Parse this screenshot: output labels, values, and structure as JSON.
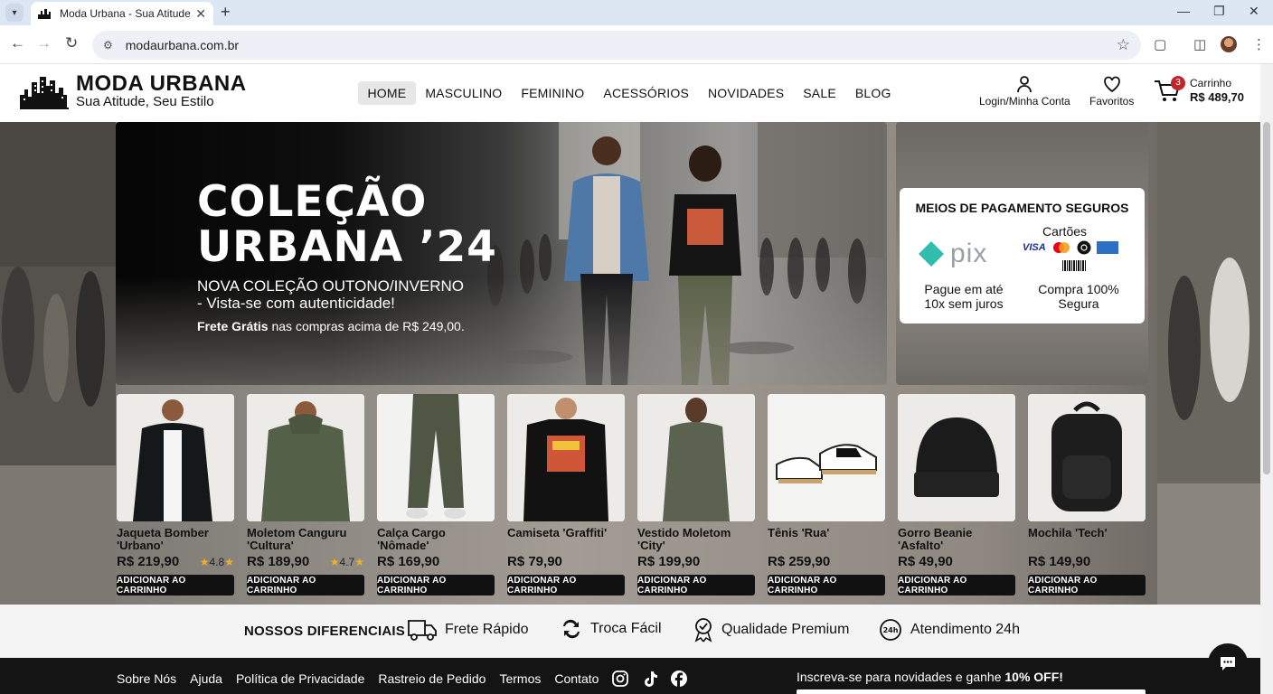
{
  "browser": {
    "tab_title": "Moda Urbana - Sua Atitude, S",
    "url": "modaurbana.com.br"
  },
  "header": {
    "brand_name": "MODA URBANA",
    "tagline": "Sua Atitude, Seu Estilo",
    "nav": [
      "HOME",
      "MASCULINO",
      "FEMININO",
      "ACESSÓRIOS",
      "NOVIDADES",
      "SALE",
      "BLOG"
    ],
    "active_nav": "HOME",
    "login_label": "Login/Minha Conta",
    "favorites_label": "Favoritos",
    "cart_label": "Carrinho",
    "cart_total": "R$ 489,70",
    "cart_count": "3"
  },
  "hero": {
    "title_line1": "COLEÇÃO",
    "title_line2": "URBANA ’24",
    "subtitle": "NOVA COLEÇÃO OUTONO/INVERNO - Vista-se com autenticidade!",
    "promo_bold": "Frete Grátis",
    "promo_rest": " nas compras acima de R$ 249,00."
  },
  "payment": {
    "title": "MEIOS DE PAGAMENTO SEGUROS",
    "pix_label": "pix",
    "cards_label": "Cartões",
    "visa_label": "VISA",
    "note_left": "Pague em até 10x sem juros",
    "note_right": "Compra 100% Segura"
  },
  "products": [
    {
      "name": "Jaqueta Bomber 'Urbano'",
      "price": "R$ 219,90",
      "rating": "4.8",
      "button": "ADICIONAR AO CARRINHO"
    },
    {
      "name": "Moletom Canguru 'Cultura'",
      "price": "R$ 189,90",
      "rating": "4.7",
      "button": "ADICIONAR AO CARRINHO"
    },
    {
      "name": "Calça Cargo 'Nômade'",
      "price": "R$ 169,90",
      "rating": "",
      "button": "ADICIONAR AO CARRINHO"
    },
    {
      "name": "Camiseta 'Graffiti'",
      "price": "R$ 79,90",
      "rating": "",
      "button": "ADICIONAR AO CARRINHO"
    },
    {
      "name": "Vestido Moletom 'City'",
      "price": "R$ 199,90",
      "rating": "",
      "button": "ADICIONAR AO CARRINHO"
    },
    {
      "name": "Tênis 'Rua'",
      "price": "R$ 259,90",
      "rating": "",
      "button": "ADICIONAR AO CARRINHO"
    },
    {
      "name": "Gorro Beanie 'Asfalto'",
      "price": "R$ 49,90",
      "rating": "",
      "button": "ADICIONAR AO CARRINHO"
    },
    {
      "name": "Mochila 'Tech'",
      "price": "R$ 149,90",
      "rating": "",
      "button": "ADICIONAR AO CARRINHO"
    }
  ],
  "features": {
    "title": "NOSSOS DIFERENCIAIS",
    "items": [
      "Frete Rápido",
      "Troca Fácil",
      "Qualidade Premium",
      "Atendimento 24h"
    ]
  },
  "footer": {
    "links": [
      "Sobre Nós",
      "Ajuda",
      "Política de Privacidade",
      "Rastreio de Pedido",
      "Termos",
      "Contato"
    ],
    "newsletter_text": "Inscreva-se para novidades e ganhe ",
    "newsletter_bold": "10% OFF!"
  },
  "colors": {
    "accent": "#111111",
    "badge": "#c0272d",
    "rating_star": "#f2b01e",
    "pix": "#32bcad"
  }
}
